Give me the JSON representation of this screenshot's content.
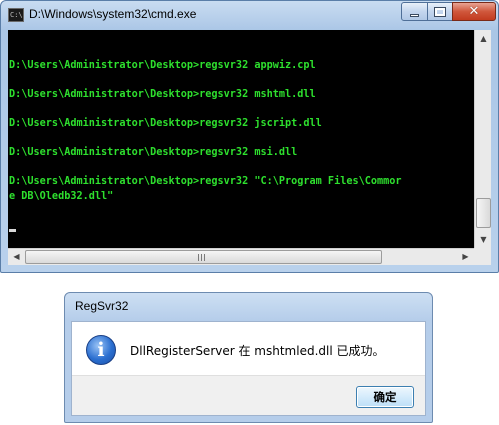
{
  "cmd_window": {
    "title": "D:\\Windows\\system32\\cmd.exe",
    "minimize_glyph": "",
    "close_glyph": "✕",
    "lines": [
      "",
      "D:\\Users\\Administrator\\Desktop>regsvr32 appwiz.cpl",
      "",
      "D:\\Users\\Administrator\\Desktop>regsvr32 mshtml.dll",
      "",
      "D:\\Users\\Administrator\\Desktop>regsvr32 jscript.dll",
      "",
      "D:\\Users\\Administrator\\Desktop>regsvr32 msi.dll",
      "",
      "D:\\Users\\Administrator\\Desktop>regsvr32 \"C:\\Program Files\\Commor",
      "e DB\\Oledb32.dll\"",
      ""
    ],
    "text_color": "#2ee02e",
    "scroll_up_glyph": "▲",
    "scroll_down_glyph": "▼",
    "scroll_left_glyph": "◀",
    "scroll_right_glyph": "▶"
  },
  "dialog": {
    "title": "RegSvr32",
    "icon_glyph": "i",
    "message": "DllRegisterServer 在 mshtmled.dll 已成功。",
    "ok_label": "确定"
  }
}
